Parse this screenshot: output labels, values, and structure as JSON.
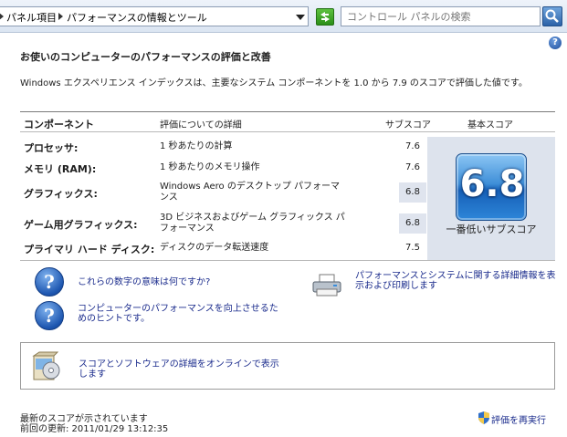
{
  "address_bar": {
    "breadcrumbs": [
      "パネル項目",
      "パフォーマンスの情報とツール"
    ]
  },
  "search": {
    "placeholder": "コントロール パネルの検索"
  },
  "help": {
    "glyph": "?"
  },
  "page": {
    "title": "お使いのコンピューターのパフォーマンスの評価と改善",
    "description": "Windows エクスペリエンス インデックスは、主要なシステム コンポーネントを 1.0 から 7.9 のスコアで評価した値です。"
  },
  "table": {
    "headers": {
      "component": "コンポーネント",
      "details": "評価についての詳細",
      "subscore": "サブスコア",
      "base_score": "基本スコア"
    },
    "rows": [
      {
        "component": "プロセッサ:",
        "detail": "1 秒あたりの計算",
        "score": "7.6"
      },
      {
        "component": "メモリ (RAM):",
        "detail": "1 秒あたりのメモリ操作",
        "score": "7.6"
      },
      {
        "component": "グラフィックス:",
        "detail": "Windows Aero のデスクトップ パフォーマンス",
        "score": "6.8"
      },
      {
        "component": "ゲーム用グラフィックス:",
        "detail": "3D ビジネスおよびゲーム グラフィックス パフォーマンス",
        "score": "6.8"
      },
      {
        "component": "プライマリ ハード ディスク:",
        "detail": "ディスクのデータ転送速度",
        "score": "7.5"
      }
    ],
    "base_score": {
      "value": "6.8",
      "caption": "一番低いサブスコア"
    }
  },
  "links": {
    "meaning": "これらの数字の意味は何ですか?",
    "improve": "コンピューターのパフォーマンスを向上させるためのヒントです。",
    "print": "パフォーマンスとシステムに関する詳細情報を表示および印刷します",
    "online": "スコアとソフトウェアの詳細をオンラインで表示します"
  },
  "footer": {
    "status": "最新のスコアが示されています",
    "last_updated": "前回の更新: 2011/01/29 13:12:35",
    "rerun": "評価を再実行"
  },
  "colors": {
    "link": "#1a2b8c",
    "score_panel": "#dde3ed",
    "score_tile": "#2d86d9"
  }
}
